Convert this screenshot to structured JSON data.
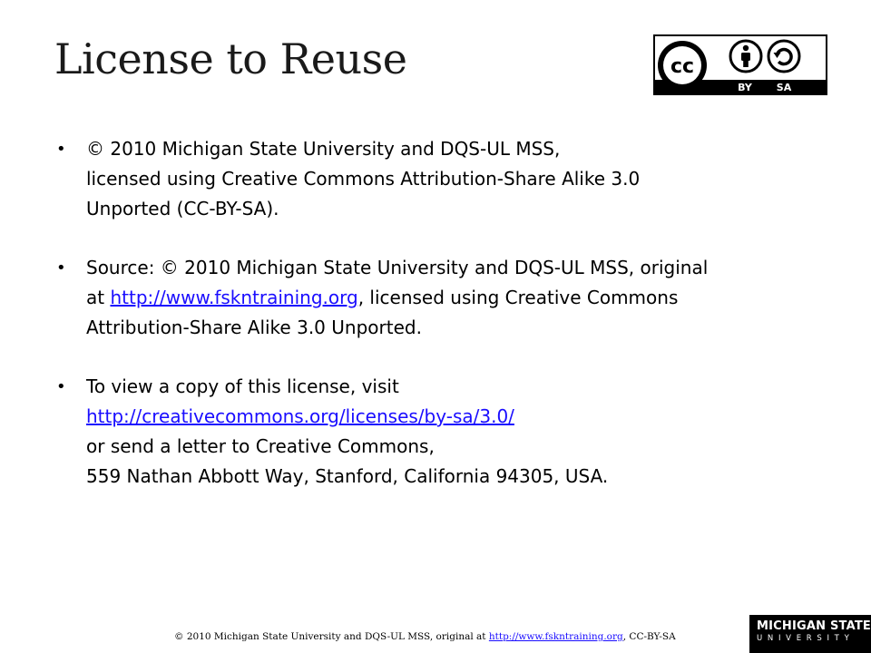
{
  "slide": {
    "title": "License to Reuse"
  },
  "cc_badge": {
    "cc_text": "cc",
    "by_label": "BY",
    "sa_label": "SA"
  },
  "bullets": [
    {
      "lines": [
        "© 2010 Michigan State University and DQS-UL MSS,",
        "licensed using Creative Commons Attribution-Share Alike 3.0",
        "Unported (CC-BY-SA)."
      ]
    },
    {
      "line1": "Source: © 2010 Michigan State University and DQS-UL MSS, original",
      "line2_prefix": "at ",
      "line2_link": "http://www.fskntraining.org",
      "line2_suffix": ", licensed using Creative Commons",
      "line3": "Attribution-Share Alike 3.0 Unported."
    },
    {
      "line1": "To view a copy of this license, visit",
      "link": "http://creativecommons.org/licenses/by-sa/3.0/",
      "line3": "or send a letter to Creative Commons,",
      "line4": "559 Nathan Abbott Way, Stanford, California 94305, USA."
    }
  ],
  "footer": {
    "prefix": "© 2010 Michigan State University and DQS-UL MSS, original at ",
    "link": "http://www.fskntraining.org",
    "suffix": ", CC-BY-SA"
  },
  "logo": {
    "top_text": "MICHIGAN STATE",
    "bottom_text": "UNIVERSITY"
  }
}
